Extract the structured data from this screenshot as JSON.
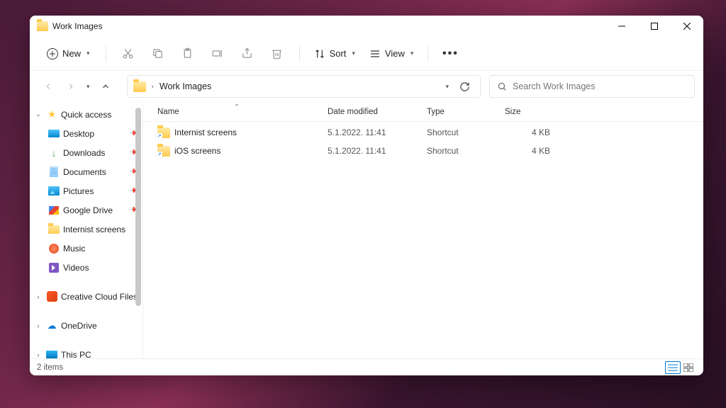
{
  "window": {
    "title": "Work Images"
  },
  "toolbar": {
    "new_label": "New",
    "sort_label": "Sort",
    "view_label": "View"
  },
  "address": {
    "crumb": "Work Images"
  },
  "search": {
    "placeholder": "Search Work Images"
  },
  "sidebar": {
    "quick_access": "Quick access",
    "items": [
      {
        "label": "Desktop",
        "pinned": true
      },
      {
        "label": "Downloads",
        "pinned": true
      },
      {
        "label": "Documents",
        "pinned": true
      },
      {
        "label": "Pictures",
        "pinned": true
      },
      {
        "label": "Google Drive",
        "pinned": true
      },
      {
        "label": "Internist screens",
        "pinned": false
      },
      {
        "label": "Music",
        "pinned": false
      },
      {
        "label": "Videos",
        "pinned": false
      }
    ],
    "creative_cloud": "Creative Cloud Files",
    "onedrive": "OneDrive",
    "this_pc": "This PC"
  },
  "columns": {
    "name": "Name",
    "date": "Date modified",
    "type": "Type",
    "size": "Size"
  },
  "rows": [
    {
      "name": "Internist screens",
      "date": "5.1.2022. 11:41",
      "type": "Shortcut",
      "size": "4 KB"
    },
    {
      "name": "iOS screens",
      "date": "5.1.2022. 11:41",
      "type": "Shortcut",
      "size": "4 KB"
    }
  ],
  "status": {
    "count": "2 items"
  }
}
